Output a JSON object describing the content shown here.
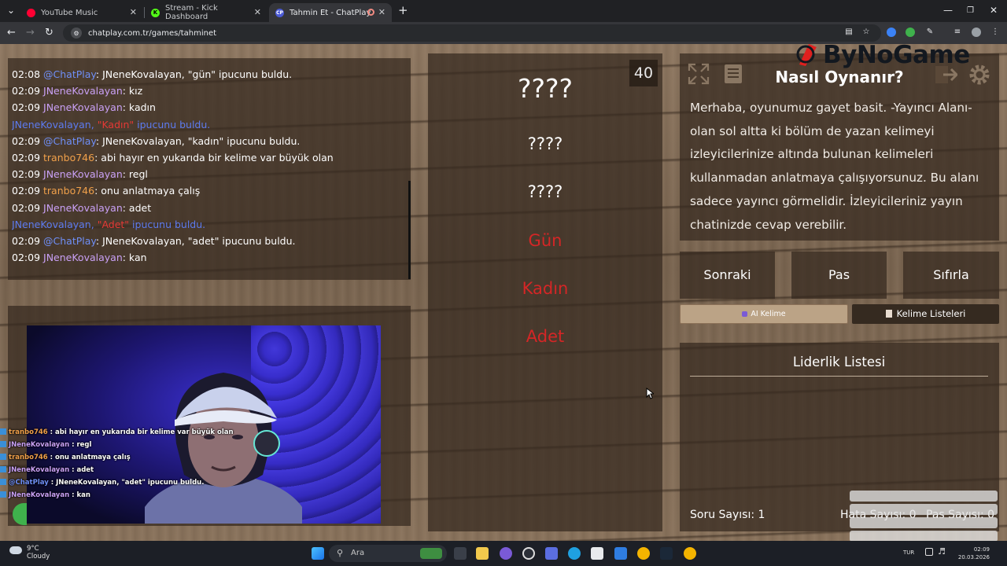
{
  "browser": {
    "tabs": [
      {
        "title": "YouTube Music",
        "favicon_color": "#ff0033",
        "active": false
      },
      {
        "title": "Stream - Kick Dashboard",
        "favicon_color": "#53fc18",
        "active": false
      },
      {
        "title": "Tahmin Et - ChatPlay",
        "favicon_label": "CP",
        "favicon_color": "#4b5bd6",
        "active": true
      }
    ],
    "new_tab_label": "+",
    "url": "chatplay.com.tr/games/tahminet"
  },
  "chat": {
    "lines": [
      {
        "time": "02:08",
        "user": "@ChatPlay",
        "user_type": "bot",
        "text": ": JNeneKovalayan, \"gün\" ipucunu buldu."
      },
      {
        "time": "02:09",
        "user": "JNeneKovalayan",
        "user_type": "viewer",
        "text": ": kız"
      },
      {
        "time": "02:09",
        "user": "JNeneKovalayan",
        "user_type": "viewer",
        "text": ": kadın"
      },
      {
        "system": true,
        "user": "JNeneKovalayan,",
        "highlight": "\"Kadın\"",
        "text": " ipucunu buldu."
      },
      {
        "time": "02:09",
        "user": "@ChatPlay",
        "user_type": "bot",
        "text": ": JNeneKovalayan, \"kadın\" ipucunu buldu."
      },
      {
        "time": "02:09",
        "user": "tranbo746",
        "user_type": "streamer",
        "text": ": abi hayır en yukarıda bir kelime var büyük olan"
      },
      {
        "time": "02:09",
        "user": "JNeneKovalayan",
        "user_type": "viewer",
        "text": ": regl"
      },
      {
        "time": "02:09",
        "user": "tranbo746",
        "user_type": "streamer",
        "text": ": onu anlatmaya çalış"
      },
      {
        "time": "02:09",
        "user": "JNeneKovalayan",
        "user_type": "viewer",
        "text": ": adet"
      },
      {
        "system": true,
        "user": "JNeneKovalayan,",
        "highlight": "\"Adet\"",
        "text": " ipucunu buldu."
      },
      {
        "time": "02:09",
        "user": "@ChatPlay",
        "user_type": "bot",
        "text": ": JNeneKovalayan, \"adet\" ipucunu buldu."
      },
      {
        "time": "02:09",
        "user": "JNeneKovalayan",
        "user_type": "viewer",
        "text": ": kan"
      }
    ]
  },
  "stream_overlay": {
    "lines": [
      {
        "user": "tranbo746",
        "user_type": "streamer",
        "text": " : abi hayır en yukarıda bir kelime var büyük olan"
      },
      {
        "user": "JNeneKovalayan",
        "user_type": "viewer",
        "text": " : regl"
      },
      {
        "user": "tranbo746",
        "user_type": "streamer",
        "text": " : onu anlatmaya çalış"
      },
      {
        "user": "JNeneKovalayan",
        "user_type": "viewer",
        "text": " : adet"
      },
      {
        "user": "@ChatPlay",
        "user_type": "bot",
        "text": " : JNeneKovalayan, \"adet\" ipucunu buldu."
      },
      {
        "user": "JNeneKovalayan",
        "user_type": "viewer",
        "text": " : kan"
      }
    ]
  },
  "game": {
    "timer": "40",
    "main_word": "????",
    "hints": [
      {
        "text": "????",
        "found": false
      },
      {
        "text": "????",
        "found": false
      },
      {
        "text": "Gün",
        "found": true
      },
      {
        "text": "Kadın",
        "found": true
      },
      {
        "text": "Adet",
        "found": true
      }
    ]
  },
  "howto": {
    "title": "Nasıl Oynanır?",
    "text": "Merhaba, oyunumuz gayet basit. -Yayıncı Alanı- olan sol altta ki bölüm de yazan kelimeyi izleyicilerinize altında bulunan kelimeleri kullanmadan anlatmaya çalışıyorsunuz. Bu alanı sadece yayıncı görmelidir. İzleyicileriniz yayın chatinizde cevap verebilir."
  },
  "logo_text": "ByNoGame",
  "actions": {
    "next": "Sonraki",
    "pass": "Pas",
    "reset": "Sıfırla",
    "ai_word": "AI Kelime",
    "word_lists": "Kelime Listeleri"
  },
  "leaderboard": {
    "title": "Liderlik Listesi",
    "question_count": "Soru Sayısı: 1",
    "error_count": "Hata Sayısı: 0",
    "pass_count": "Pas Sayısı: 0"
  },
  "taskbar": {
    "weather_temp": "9°C",
    "weather_desc": "Cloudy",
    "search_placeholder": "Ara",
    "lang": "TUR",
    "time": "02:09",
    "date": "20.03.2026"
  }
}
